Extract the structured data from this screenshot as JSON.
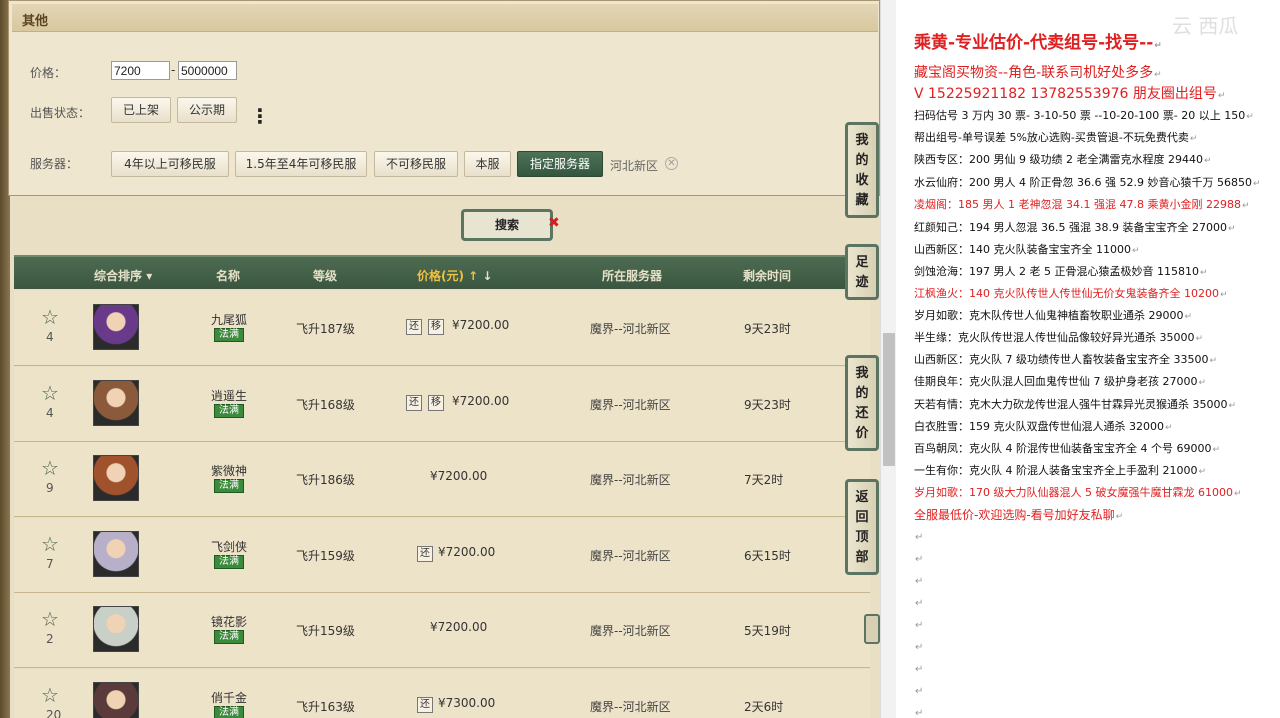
{
  "filters": {
    "section_title": "其他",
    "price_label": "价格：",
    "price_min": "7200",
    "price_max": "5000000",
    "price_dash": "-",
    "sale_status_label": "出售状态：",
    "status_buttons": [
      "已上架",
      "公示期"
    ],
    "server_label": "服务器：",
    "server_buttons": [
      "4年以上可移民服",
      "1.5年至4年可移民服",
      "不可移民服",
      "本服",
      "指定服务器"
    ],
    "active_server_index": 4,
    "selected_region": "河北新区",
    "search_label": "搜索"
  },
  "table": {
    "headers": {
      "sort": "综合排序",
      "name": "名称",
      "level": "等级",
      "price": "价格(元)",
      "server": "所在服务器",
      "time": "剩余时间"
    },
    "rows": [
      {
        "count": "4",
        "name": "九尾狐",
        "badge": "法满",
        "level": "飞升187级",
        "tags": [
          "还",
          "移"
        ],
        "price": "¥7200.00",
        "server": "魔界--河北新区",
        "time": "9天23时",
        "avatar": "#6a3a8a"
      },
      {
        "count": "4",
        "name": "逍遥生",
        "badge": "法满",
        "level": "飞升168级",
        "tags": [
          "还",
          "移"
        ],
        "price": "¥7200.00",
        "server": "魔界--河北新区",
        "time": "9天23时",
        "avatar": "#8a5a3a"
      },
      {
        "count": "9",
        "name": "紫微神",
        "badge": "法满",
        "level": "飞升186级",
        "tags": [],
        "price": "¥7200.00",
        "server": "魔界--河北新区",
        "time": "7天2时",
        "avatar": "#a0522d"
      },
      {
        "count": "7",
        "name": "飞剑侠",
        "badge": "法满",
        "level": "飞升159级",
        "tags": [
          "还"
        ],
        "price": "¥7200.00",
        "server": "魔界--河北新区",
        "time": "6天15时",
        "avatar": "#b8b0c8"
      },
      {
        "count": "2",
        "name": "镜花影",
        "badge": "法满",
        "level": "飞升159级",
        "tags": [],
        "price": "¥7200.00",
        "server": "魔界--河北新区",
        "time": "5天19时",
        "avatar": "#c8d0c8"
      },
      {
        "count": "20",
        "name": "俏千金",
        "badge": "法满",
        "level": "飞升163级",
        "tags": [
          "还"
        ],
        "price": "¥7300.00",
        "server": "魔界--河北新区",
        "time": "2天6时",
        "avatar": "#5a3a3a"
      }
    ]
  },
  "side_nav": [
    "我的收藏",
    "足迹",
    "我的还价",
    "返回顶部"
  ],
  "doc": {
    "lines": [
      {
        "text": "乘黄-专业估价-代卖组号-找号--",
        "style": "big"
      },
      {
        "text": "藏宝阁买物资--角色-联系司机好处多多",
        "style": "mid"
      },
      {
        "text": "V 15225921182      13782553976 朋友圈出组号",
        "style": "mid"
      },
      {
        "text": "扫码估号 3 万内 30 票- 3-10-50 票  --10-20-100 票- 20 以上 150",
        "style": "norm"
      },
      {
        "text": "帮出组号-单号误差 5%放心选购-买贵管退-不玩免费代卖",
        "style": "norm"
      },
      {
        "text": "陕西专区：200 男仙 9 级功绩 2 老全满雷克水程度 29440",
        "style": "norm"
      },
      {
        "text": "水云仙府：200 男人 4 阶正骨忽 36.6 强 52.9 妙音心猿千万 56850",
        "style": "norm"
      },
      {
        "text": "凌烟阁：185 男人 1 老神忽混 34.1 强混 47.8 乘黄小金刚 22988",
        "style": "red"
      },
      {
        "text": "红颜知己：194 男人忽混 36.5 强混 38.9 装备宝宝齐全 27000",
        "style": "norm"
      },
      {
        "text": "山西新区：140 克火队装备宝宝齐全 11000",
        "style": "norm"
      },
      {
        "text": "剑蚀沧海：197 男人 2 老 5 正骨混心猿孟极妙音 115810",
        "style": "norm"
      },
      {
        "text": "江枫渔火：140 克火队传世人传世仙无价女鬼装备齐全 10200",
        "style": "red"
      },
      {
        "text": "岁月如歌：克木队传世人仙鬼神植畜牧职业通杀 29000",
        "style": "norm"
      },
      {
        "text": "半生缘：克火队传世混人传世仙品像较好异光通杀 35000",
        "style": "norm"
      },
      {
        "text": "山西新区：克火队 7 级功绩传世人畜牧装备宝宝齐全 33500",
        "style": "norm"
      },
      {
        "text": "佳期良年：克火队混人回血鬼传世仙 7 级护身老孩 27000",
        "style": "norm"
      },
      {
        "text": "天若有情：克木大力砍龙传世混人强牛甘霖异光灵猴通杀 35000",
        "style": "norm"
      },
      {
        "text": "白衣胜雪：159 克火队双盘传世仙混人通杀 32000",
        "style": "norm"
      },
      {
        "text": "百鸟朝凤：克火队 4 阶混传世仙装备宝宝齐全 4 个号 69000",
        "style": "norm"
      },
      {
        "text": "一生有你：克火队 4 阶混人装备宝宝齐全上手盈利 21000",
        "style": "norm"
      },
      {
        "text": "岁月如歌：170 级大力队仙器混人 5 破女魔强牛魔甘霖龙 61000",
        "style": "red"
      },
      {
        "text": "全服最低价-欢迎选购-看号加好友私聊",
        "style": "mid-small"
      }
    ],
    "empty_marks": 9,
    "watermark": "云 西瓜"
  }
}
